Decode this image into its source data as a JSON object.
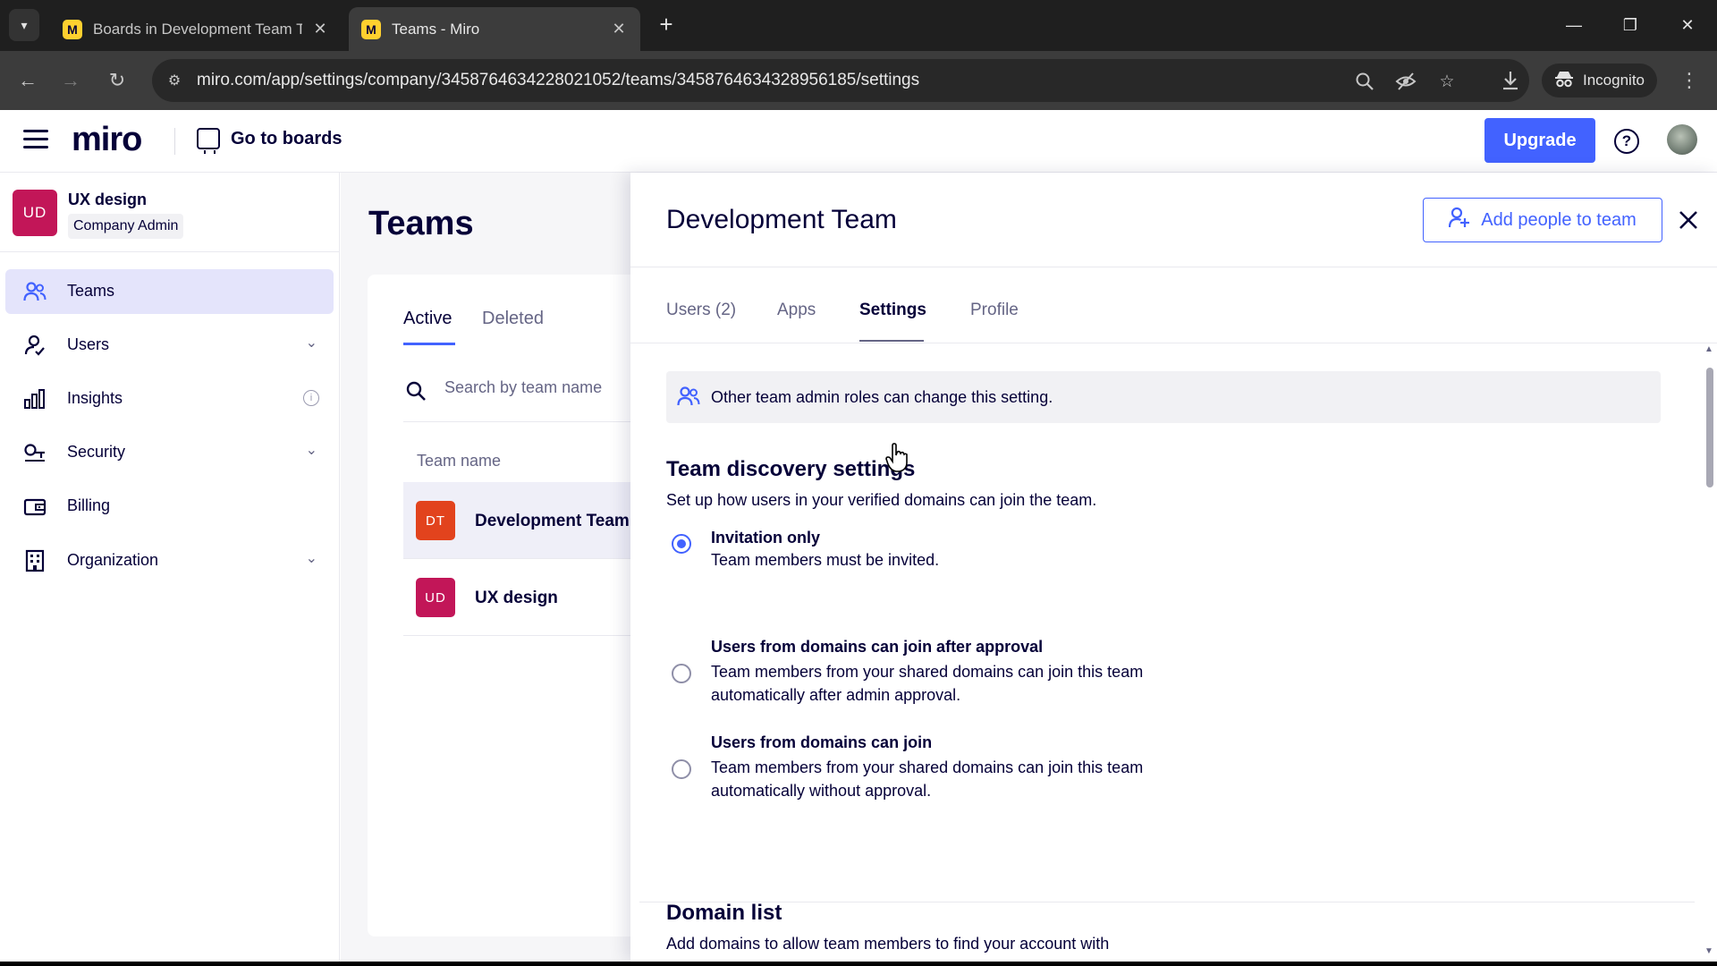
{
  "browser": {
    "tabs": [
      {
        "title": "Boards in Development Team T",
        "favicon": "miro-favicon",
        "active": false
      },
      {
        "title": "Teams - Miro",
        "favicon": "miro-favicon",
        "active": true
      }
    ],
    "favicon_glyph": "M",
    "close_glyph": "✕",
    "new_tab_glyph": "+",
    "url": "miro.com/app/settings/company/3458764634228021052/teams/3458764634328956185/settings",
    "incognito_label": "Incognito"
  },
  "header": {
    "logo": "miro",
    "go_to_boards": "Go to boards",
    "upgrade": "Upgrade",
    "help_glyph": "?"
  },
  "sidebar": {
    "org_initials": "UD",
    "org_name": "UX design",
    "org_role": "Company Admin",
    "items": [
      {
        "label": "Teams",
        "icon": "people-icon",
        "active": true,
        "chevron": false
      },
      {
        "label": "Users",
        "icon": "user-icon",
        "active": false,
        "chevron": true
      },
      {
        "label": "Insights",
        "icon": "bar-chart-icon",
        "active": false,
        "info": true
      },
      {
        "label": "Security",
        "icon": "key-icon",
        "active": false,
        "chevron": true
      },
      {
        "label": "Billing",
        "icon": "wallet-icon",
        "active": false
      },
      {
        "label": "Organization",
        "icon": "building-icon",
        "active": false,
        "chevron": true
      }
    ],
    "chevron_glyph": "⌄",
    "info_glyph": "i"
  },
  "teams_list": {
    "title": "Teams",
    "tabs": [
      "Active",
      "Deleted"
    ],
    "search_placeholder": "Search by team name",
    "column_header": "Team name",
    "rows": [
      {
        "initials": "DT",
        "name": "Development Team",
        "color": "#e2431d"
      },
      {
        "initials": "UD",
        "name": "UX design",
        "color": "#c21658"
      }
    ]
  },
  "drawer": {
    "title": "Development Team",
    "add_people": "Add people to team",
    "tabs": [
      "Users (2)",
      "Apps",
      "Settings",
      "Profile"
    ],
    "active_tab": "Settings",
    "notice": "Other team admin roles can change this setting.",
    "discovery": {
      "title": "Team discovery settings",
      "description": "Set up how users in your verified domains can join the team.",
      "options": [
        {
          "title": "Invitation only",
          "description": "Team members must be invited.",
          "checked": true
        },
        {
          "title": "Users from domains can join after approval",
          "description": "Team members from your shared domains can join this team automatically after admin approval.",
          "checked": false
        },
        {
          "title": "Users from domains can join",
          "description": "Team members from your shared domains can join this team automatically without approval.",
          "checked": false
        }
      ]
    },
    "domain_list": {
      "title": "Domain list",
      "description": "Add domains to allow team members to find your account with"
    }
  },
  "colors": {
    "accent": "#4262ff",
    "text": "#050038",
    "muted": "#656585"
  }
}
